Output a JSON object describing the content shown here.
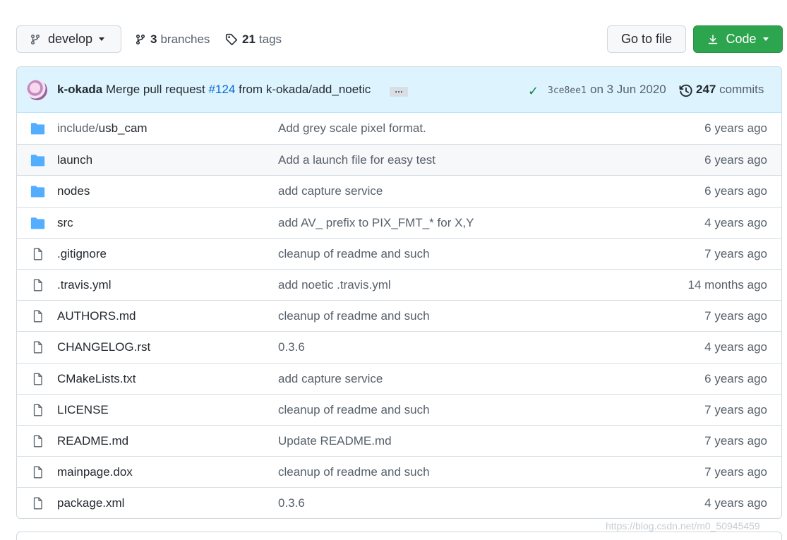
{
  "branch": {
    "name": "develop"
  },
  "branches": {
    "count": "3",
    "label": "branches"
  },
  "tags": {
    "count": "21",
    "label": "tags"
  },
  "buttons": {
    "go_to_file": "Go to file",
    "code": "Code"
  },
  "commit": {
    "author": "k-okada",
    "message_prefix": "Merge pull request",
    "pr": "#124",
    "message_suffix": "from k-okada/add_noetic",
    "ellipsis": "…",
    "sha": "3ce8ee1",
    "date": "on 3 Jun 2020",
    "count": "247",
    "count_label": "commits"
  },
  "files": [
    {
      "type": "dir",
      "prefix": "include/",
      "name": "usb_cam",
      "message": "Add grey scale pixel format.",
      "age": "6 years ago"
    },
    {
      "type": "dir",
      "prefix": "",
      "name": "launch",
      "message": "Add a launch file for easy test",
      "age": "6 years ago"
    },
    {
      "type": "dir",
      "prefix": "",
      "name": "nodes",
      "message": "add capture service",
      "age": "6 years ago"
    },
    {
      "type": "dir",
      "prefix": "",
      "name": "src",
      "message": "add AV_ prefix to PIX_FMT_* for X,Y",
      "age": "4 years ago"
    },
    {
      "type": "file",
      "prefix": "",
      "name": ".gitignore",
      "message": "cleanup of readme and such",
      "age": "7 years ago"
    },
    {
      "type": "file",
      "prefix": "",
      "name": ".travis.yml",
      "message": "add noetic .travis.yml",
      "age": "14 months ago"
    },
    {
      "type": "file",
      "prefix": "",
      "name": "AUTHORS.md",
      "message": "cleanup of readme and such",
      "age": "7 years ago"
    },
    {
      "type": "file",
      "prefix": "",
      "name": "CHANGELOG.rst",
      "message": "0.3.6",
      "age": "4 years ago"
    },
    {
      "type": "file",
      "prefix": "",
      "name": "CMakeLists.txt",
      "message": "add capture service",
      "age": "6 years ago"
    },
    {
      "type": "file",
      "prefix": "",
      "name": "LICENSE",
      "message": "cleanup of readme and such",
      "age": "7 years ago"
    },
    {
      "type": "file",
      "prefix": "",
      "name": "README.md",
      "message": "Update README.md",
      "age": "7 years ago"
    },
    {
      "type": "file",
      "prefix": "",
      "name": "mainpage.dox",
      "message": "cleanup of readme and such",
      "age": "7 years ago"
    },
    {
      "type": "file",
      "prefix": "",
      "name": "package.xml",
      "message": "0.3.6",
      "age": "4 years ago"
    }
  ],
  "watermark": "https://blog.csdn.net/m0_50945459",
  "colors": {
    "folder": "#54aeff",
    "primary": "#2da44e",
    "link": "#0969da",
    "commit_bar": "#ddf4ff"
  }
}
